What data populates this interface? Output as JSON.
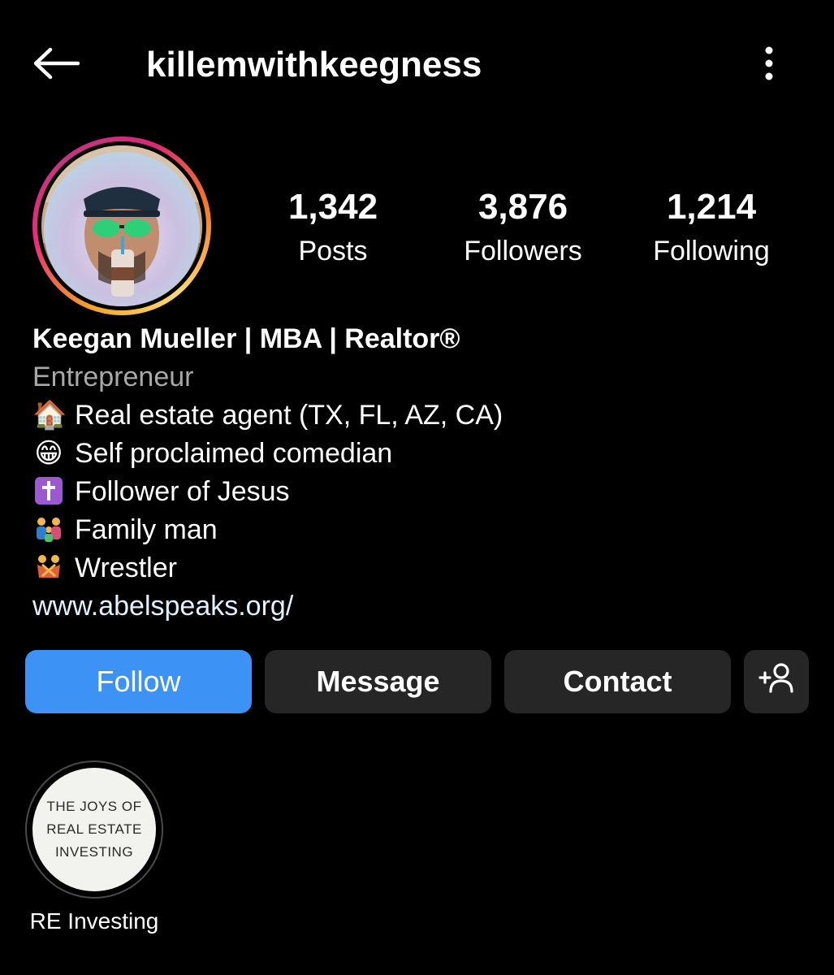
{
  "header": {
    "username": "killemwithkeegness",
    "back_icon": "arrow-left-icon",
    "more_icon": "more-vertical-icon"
  },
  "profile": {
    "stats": {
      "posts": {
        "count": "1,342",
        "label": "Posts"
      },
      "followers": {
        "count": "3,876",
        "label": "Followers"
      },
      "following": {
        "count": "1,214",
        "label": "Following"
      }
    },
    "bio": {
      "name": "Keegan Mueller | MBA | Realtor®",
      "category": "Entrepreneur",
      "lines": [
        {
          "emoji": "🏠",
          "text": "Real estate agent (TX, FL, AZ, CA)"
        },
        {
          "emoji": "😁",
          "text": "Self proclaimed comedian"
        },
        {
          "emoji": "✝",
          "text": "Follower of Jesus"
        },
        {
          "emoji": "👨‍👩‍👧",
          "text": "Family man"
        },
        {
          "emoji": "🤼",
          "text": "Wrestler"
        }
      ],
      "link": "www.abelspeaks.org/"
    }
  },
  "actions": {
    "follow": "Follow",
    "message": "Message",
    "contact": "Contact",
    "suggest_icon": "add-person-icon"
  },
  "highlights": [
    {
      "cover_lines": [
        "THE JOYS OF",
        "REAL ESTATE",
        "INVESTING"
      ],
      "label": "RE Investing"
    }
  ],
  "colors": {
    "background": "#000000",
    "follow_button": "#3d93f5",
    "secondary_button": "#262626",
    "muted_text": "#a8a8a8",
    "link_text": "#e0f1ff"
  }
}
